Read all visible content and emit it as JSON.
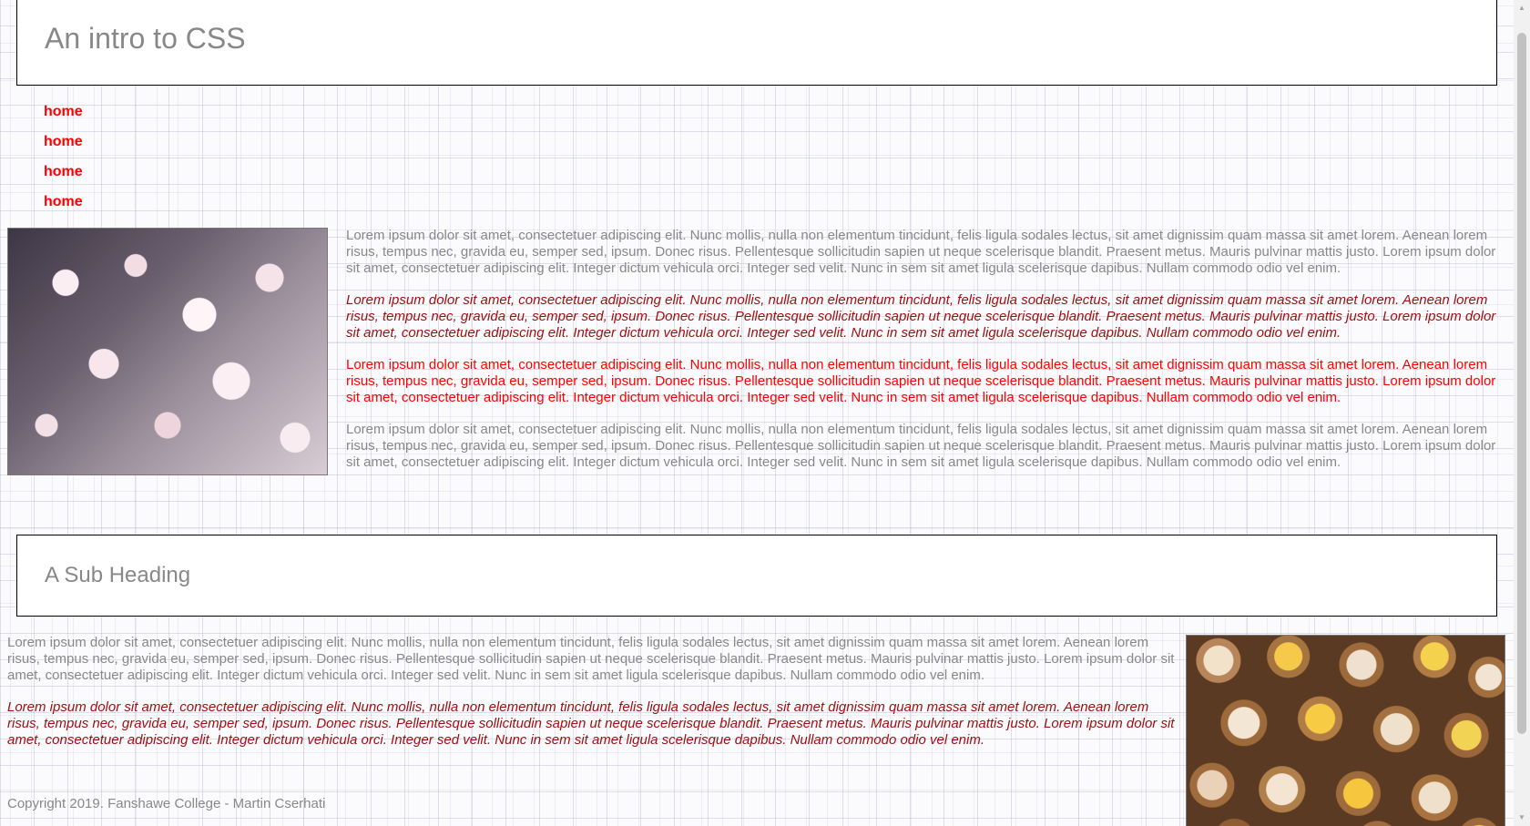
{
  "header": {
    "title": "An intro to CSS"
  },
  "nav": {
    "items": [
      {
        "label": "home"
      },
      {
        "label": "home"
      },
      {
        "label": "home"
      },
      {
        "label": "home"
      }
    ]
  },
  "section1": {
    "image_icon": "cherry-blossom-photo",
    "paragraphs": [
      "Lorem ipsum dolor sit amet, consectetuer adipiscing elit. Nunc mollis, nulla non elementum tincidunt, felis ligula sodales lectus, sit amet dignissim quam massa sit amet lorem. Aenean lorem risus, tempus nec, gravida eu, semper sed, ipsum. Donec risus. Pellentesque sollicitudin sapien ut neque scelerisque blandit. Praesent metus. Mauris pulvinar mattis justo. Lorem ipsum dolor sit amet, consectetuer adipiscing elit. Integer dictum vehicula orci. Integer sed velit. Nunc in sem sit amet ligula scelerisque dapibus. Nullam commodo odio vel enim.",
      "Lorem ipsum dolor sit amet, consectetuer adipiscing elit. Nunc mollis, nulla non elementum tincidunt, felis ligula sodales lectus, sit amet dignissim quam massa sit amet lorem. Aenean lorem risus, tempus nec, gravida eu, semper sed, ipsum. Donec risus. Pellentesque sollicitudin sapien ut neque scelerisque blandit. Praesent metus. Mauris pulvinar mattis justo. Lorem ipsum dolor sit amet, consectetuer adipiscing elit. Integer dictum vehicula orci. Integer sed velit. Nunc in sem sit amet ligula scelerisque dapibus. Nullam commodo odio vel enim.",
      "Lorem ipsum dolor sit amet, consectetuer adipiscing elit. Nunc mollis, nulla non elementum tincidunt, felis ligula sodales lectus, sit amet dignissim quam massa sit amet lorem. Aenean lorem risus, tempus nec, gravida eu, semper sed, ipsum. Donec risus. Pellentesque sollicitudin sapien ut neque scelerisque blandit. Praesent metus. Mauris pulvinar mattis justo. Lorem ipsum dolor sit amet, consectetuer adipiscing elit. Integer dictum vehicula orci. Integer sed velit. Nunc in sem sit amet ligula scelerisque dapibus. Nullam commodo odio vel enim.",
      "Lorem ipsum dolor sit amet, consectetuer adipiscing elit. Nunc mollis, nulla non elementum tincidunt, felis ligula sodales lectus, sit amet dignissim quam massa sit amet lorem. Aenean lorem risus, tempus nec, gravida eu, semper sed, ipsum. Donec risus. Pellentesque sollicitudin sapien ut neque scelerisque blandit. Praesent metus. Mauris pulvinar mattis justo. Lorem ipsum dolor sit amet, consectetuer adipiscing elit. Integer dictum vehicula orci. Integer sed velit. Nunc in sem sit amet ligula scelerisque dapibus. Nullam commodo odio vel enim."
    ]
  },
  "subheading": {
    "title": "A Sub Heading"
  },
  "section2": {
    "image_icon": "dim-sum-photo",
    "paragraphs": [
      "Lorem ipsum dolor sit amet, consectetuer adipiscing elit. Nunc mollis, nulla non elementum tincidunt, felis ligula sodales lectus, sit amet dignissim quam massa sit amet lorem. Aenean lorem risus, tempus nec, gravida eu, semper sed, ipsum. Donec risus. Pellentesque sollicitudin sapien ut neque scelerisque blandit. Praesent metus. Mauris pulvinar mattis justo. Lorem ipsum dolor sit amet, consectetuer adipiscing elit. Integer dictum vehicula orci. Integer sed velit. Nunc in sem sit amet ligula scelerisque dapibus. Nullam commodo odio vel enim.",
      "Lorem ipsum dolor sit amet, consectetuer adipiscing elit. Nunc mollis, nulla non elementum tincidunt, felis ligula sodales lectus, sit amet dignissim quam massa sit amet lorem. Aenean lorem risus, tempus nec, gravida eu, semper sed, ipsum. Donec risus. Pellentesque sollicitudin sapien ut neque scelerisque blandit. Praesent metus. Mauris pulvinar mattis justo. Lorem ipsum dolor sit amet, consectetuer adipiscing elit. Integer dictum vehicula orci. Integer sed velit. Nunc in sem sit amet ligula scelerisque dapibus. Nullam commodo odio vel enim."
    ]
  },
  "footer": {
    "text": "Copyright 2019. Fanshawe College - Martin Cserhati"
  },
  "colors": {
    "nav_link": "#ff0000",
    "body_text": "#888888",
    "italic_text": "#a01010",
    "red_text": "#ff0000"
  },
  "icons": {
    "scroll_up": "scroll-up-arrow-icon",
    "scroll_down": "scroll-down-arrow-icon"
  }
}
